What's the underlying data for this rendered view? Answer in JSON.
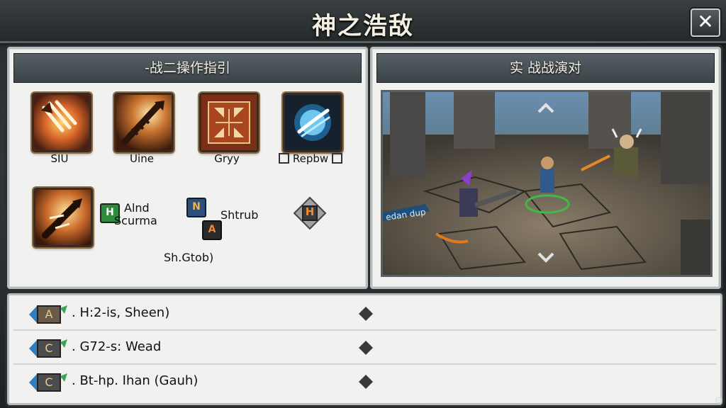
{
  "window": {
    "title": "神之浩敌",
    "close_icon": "close-icon"
  },
  "left_panel": {
    "header": "-战二操作指引",
    "skills": [
      {
        "label": "SIU",
        "icon": "claw-slash-icon"
      },
      {
        "label": "Uine",
        "icon": "spear-strike-icon"
      },
      {
        "label": "Gryy",
        "icon": "rune-grid-icon"
      },
      {
        "label": "Repbw",
        "icon": "lightning-orb-icon"
      },
      {
        "label": "",
        "icon": "blade-thrust-icon"
      }
    ],
    "combo": {
      "key": "H",
      "line1": "Alnd",
      "line2": "Scurma"
    },
    "shrub": {
      "key_top": "N",
      "key_bottom": "A",
      "label": "Shtrub"
    },
    "diamond_key": "H",
    "footer_label": "Sh.Gtob)"
  },
  "right_panel": {
    "header": "实 战战演对",
    "preview_caption": "edan dup"
  },
  "bindings": [
    {
      "key": "A",
      "text": "H:2-is, Sheen)"
    },
    {
      "key": "C",
      "text": "G72-s: Wead"
    },
    {
      "key": "C",
      "text": "Bt-hp. Ihan (Gauh)"
    }
  ],
  "colors": {
    "accent_blue": "#2f7fc0",
    "accent_green": "#3aa655",
    "skill_frame": "#8a6a42"
  }
}
